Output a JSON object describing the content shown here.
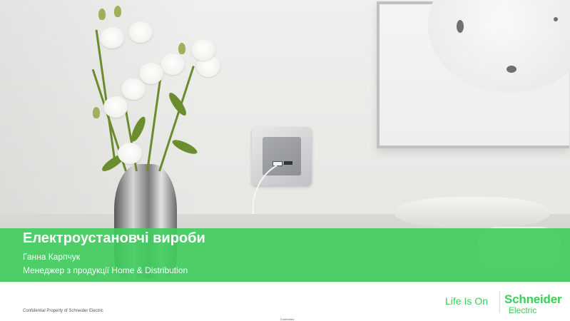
{
  "slide": {
    "title": "Електроустановчі вироби",
    "presenter": "Ганна Карпчук",
    "role": "Менеджер з продукції Home & Distribution"
  },
  "footer": {
    "confidential": "Confidential Property of Schneider Electric",
    "tag": "Embedded"
  },
  "branding": {
    "tagline": "Life Is On",
    "logo_top": "Schneider",
    "logo_bottom": "Electric"
  },
  "colors": {
    "accent": "#3dcd58",
    "band": "#3ecd5c"
  },
  "icons": {
    "logo": "schneider-electric-logo"
  }
}
